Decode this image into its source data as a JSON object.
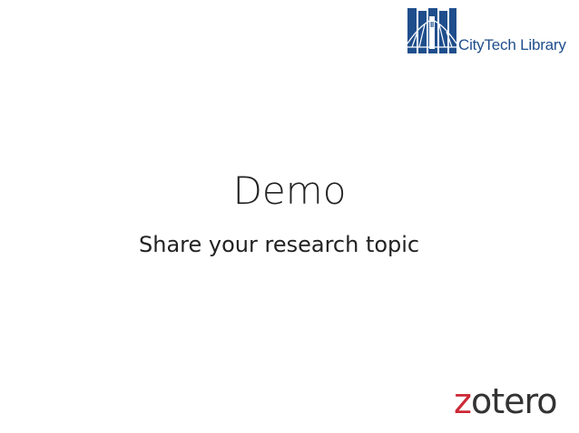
{
  "slide": {
    "title": "Demo",
    "subtitle": "Share your research topic"
  },
  "logos": {
    "citytech": {
      "text": "CityTech Library",
      "color": "#1f4e8c"
    },
    "zotero": {
      "text": "zotero",
      "accent_color": "#cc2936",
      "text_color": "#333333"
    }
  }
}
